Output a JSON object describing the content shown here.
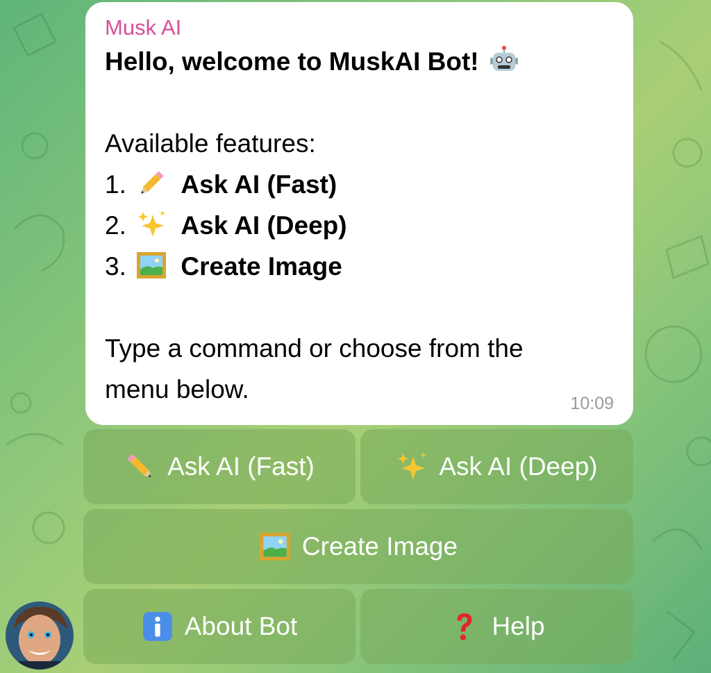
{
  "chat": {
    "sender_name": "Musk AI",
    "greeting": "Hello, welcome to MuskAI Bot!",
    "features_heading": "Available features:",
    "features": [
      {
        "number": "1.",
        "icon": "pencil-icon",
        "label": "Ask AI (Fast)"
      },
      {
        "number": "2.",
        "icon": "sparkles-icon",
        "label": "Ask AI (Deep)"
      },
      {
        "number": "3.",
        "icon": "framed-picture-icon",
        "label": "Create Image"
      }
    ],
    "instruction_line1": "Type a command or choose from the",
    "instruction_line2": "menu below.",
    "time": "10:09"
  },
  "keyboard": {
    "ask_fast": "Ask AI (Fast)",
    "ask_deep": "Ask AI (Deep)",
    "create_image": "Create Image",
    "about_bot": "About Bot",
    "help": "Help"
  },
  "colors": {
    "sender_name": "#d84f96",
    "bubble": "#ffffff",
    "button_text": "#ffffff",
    "timestamp": "#9a9a9a"
  }
}
